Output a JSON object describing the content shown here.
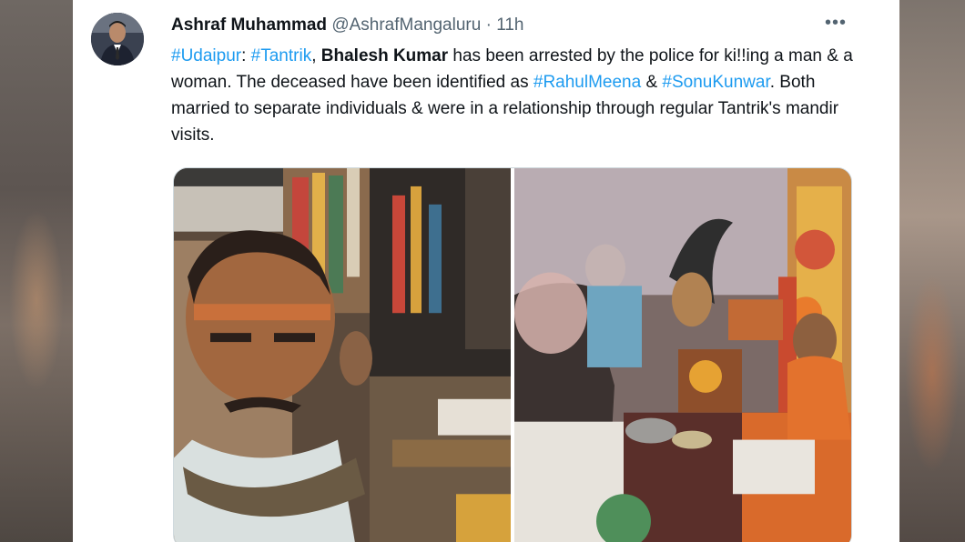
{
  "tweet": {
    "author_name": "Ashraf Muhammad",
    "author_handle": "@AshrafMangaluru",
    "separator": "·",
    "timestamp": "11h",
    "more_icon": "more-horizontal-icon",
    "text": {
      "hashtag_udaipur": "#Udaipur",
      "colon": ": ",
      "hashtag_tantrik": "#Tantrik",
      "comma": ", ",
      "name_bold": "Bhalesh Kumar",
      "part1": " has been arrested by the police for ki!!ing a man & a woman. The deceased have been identified as ",
      "hashtag_rahul": "#RahulMeena",
      "amp": " & ",
      "hashtag_sonu": "#SonuKunwar",
      "part2": ". Both married to separate individuals & were in a relationship through regular Tantrik's mandir visits."
    },
    "link_color": "#1d9bf0",
    "text_color": "#0f1419",
    "muted_color": "#536471"
  }
}
